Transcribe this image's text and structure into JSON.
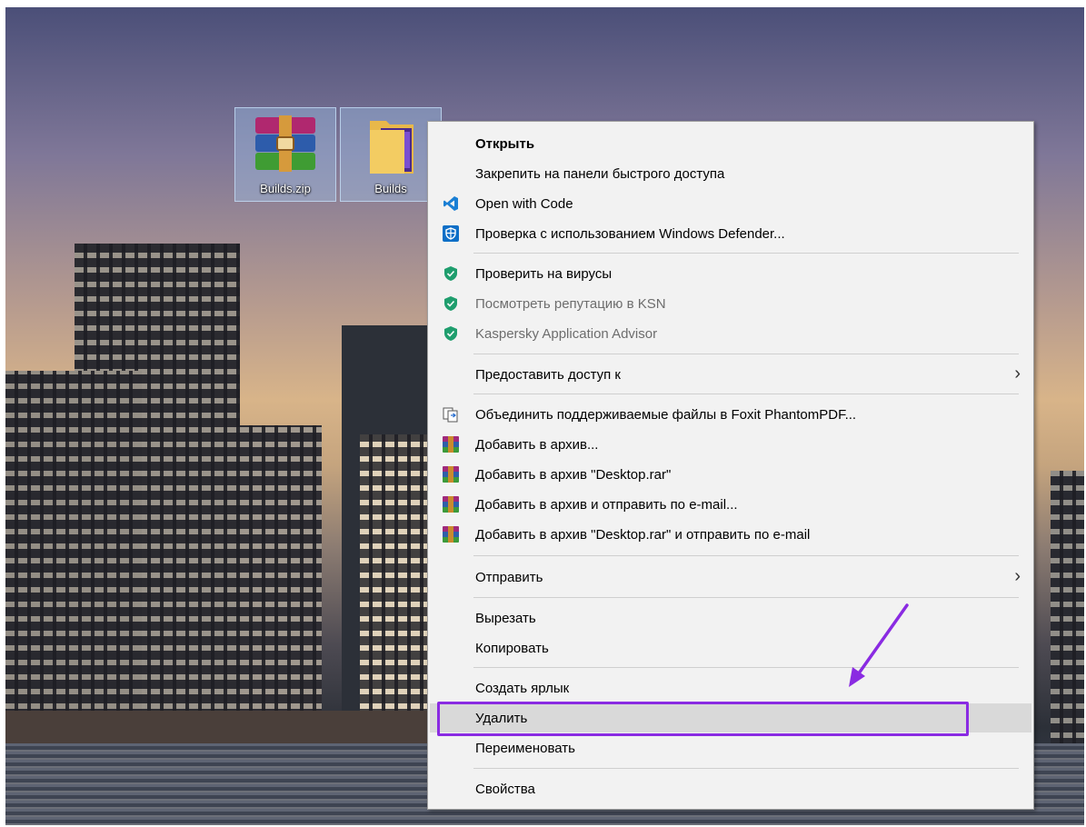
{
  "desktop": {
    "icons": [
      {
        "label": "Builds.zip",
        "icon": "winrar-archive-icon"
      },
      {
        "label": "Builds",
        "icon": "folder-icon"
      }
    ]
  },
  "context_menu": {
    "items": [
      {
        "label": "Открыть",
        "bold": true
      },
      {
        "label": "Закрепить на панели быстрого доступа"
      },
      {
        "label": "Open with Code",
        "icon": "vscode-icon"
      },
      {
        "label": "Проверка с использованием Windows Defender...",
        "icon": "windows-defender-icon"
      },
      {
        "label": "Проверить на вирусы",
        "icon": "kaspersky-shield-icon"
      },
      {
        "label": "Посмотреть репутацию в KSN",
        "icon": "kaspersky-shield-icon",
        "disabled": true
      },
      {
        "label": "Kaspersky Application Advisor",
        "icon": "kaspersky-shield-icon",
        "disabled": true
      },
      {
        "label": "Предоставить доступ к",
        "submenu": true
      },
      {
        "label": "Объединить поддерживаемые файлы в Foxit PhantomPDF...",
        "icon": "foxit-icon"
      },
      {
        "label": "Добавить в архив...",
        "icon": "winrar-icon"
      },
      {
        "label": "Добавить в архив \"Desktop.rar\"",
        "icon": "winrar-icon"
      },
      {
        "label": "Добавить в архив и отправить по e-mail...",
        "icon": "winrar-icon"
      },
      {
        "label": "Добавить в архив \"Desktop.rar\" и отправить по e-mail",
        "icon": "winrar-icon"
      },
      {
        "label": "Отправить",
        "submenu": true
      },
      {
        "label": "Вырезать"
      },
      {
        "label": "Копировать"
      },
      {
        "label": "Создать ярлык"
      },
      {
        "label": "Удалить",
        "highlighted": true
      },
      {
        "label": "Переименовать"
      },
      {
        "label": "Свойства"
      }
    ],
    "submenu_arrow": "›"
  },
  "annotation": {
    "color": "#8a2be2"
  }
}
